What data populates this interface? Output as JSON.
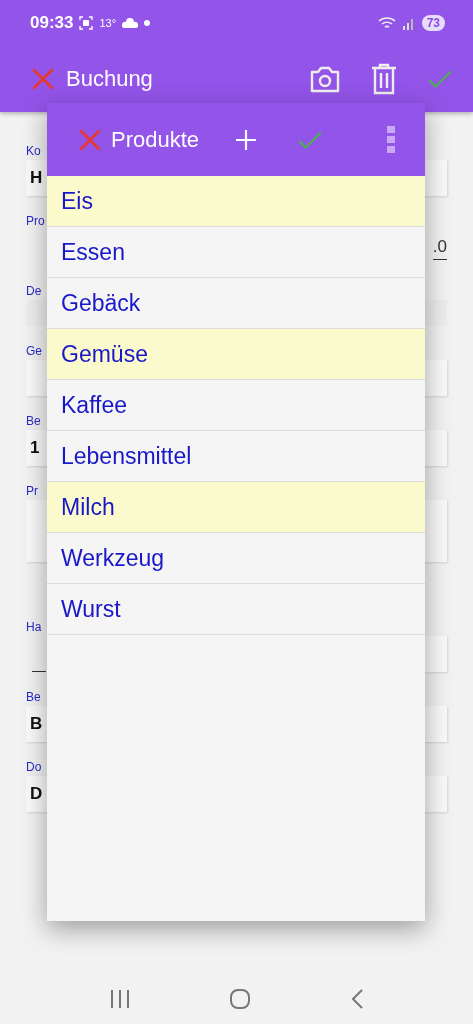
{
  "status_bar": {
    "time": "09:33",
    "temperature": "13°",
    "battery": "73"
  },
  "app_bar": {
    "title": "Buchung"
  },
  "form": {
    "fields": [
      {
        "label": "Ko",
        "value": "H",
        "kind": "box"
      },
      {
        "label": "Pro",
        "value": ".0",
        "kind": "line"
      },
      {
        "label": "De",
        "kind": "flat"
      },
      {
        "label": "Ge",
        "kind": "box"
      },
      {
        "label": "Be",
        "value": "1",
        "kind": "box"
      },
      {
        "label": "Pr",
        "kind": "tall"
      },
      {
        "label": "Ha",
        "kind": "split"
      },
      {
        "label": "Be",
        "value": "B",
        "kind": "box"
      },
      {
        "label": "Do",
        "value": "D",
        "kind": "box"
      }
    ]
  },
  "dialog": {
    "title": "Produkte",
    "items": [
      {
        "label": "Eis",
        "highlighted": true
      },
      {
        "label": "Essen",
        "highlighted": false
      },
      {
        "label": "Gebäck",
        "highlighted": false
      },
      {
        "label": "Gemüse",
        "highlighted": true
      },
      {
        "label": "Kaffee",
        "highlighted": false
      },
      {
        "label": "Lebensmittel",
        "highlighted": false
      },
      {
        "label": "Milch",
        "highlighted": true
      },
      {
        "label": "Werkzeug",
        "highlighted": false
      },
      {
        "label": "Wurst",
        "highlighted": false
      }
    ]
  }
}
